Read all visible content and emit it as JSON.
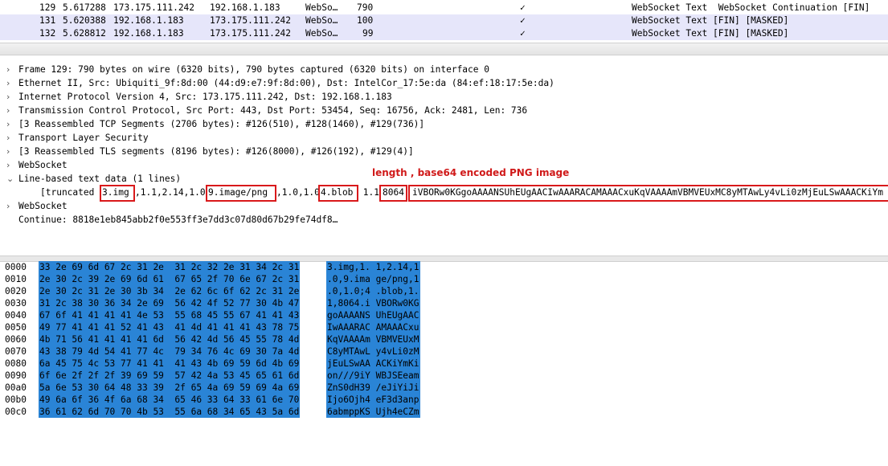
{
  "packets": [
    {
      "no": "129",
      "time": "5.617288",
      "src": "173.175.111.242",
      "dst": "192.168.1.183",
      "proto": "WebSo…",
      "len": "790",
      "check": "✓",
      "info": "WebSocket Text  WebSocket Continuation [FIN]"
    },
    {
      "no": "131",
      "time": "5.620388",
      "src": "192.168.1.183",
      "dst": "173.175.111.242",
      "proto": "WebSo…",
      "len": "100",
      "check": "✓",
      "info": "WebSocket Text [FIN] [MASKED]"
    },
    {
      "no": "132",
      "time": "5.628812",
      "src": "192.168.1.183",
      "dst": "173.175.111.242",
      "proto": "WebSo…",
      "len": "99",
      "check": "✓",
      "info": "WebSocket Text [FIN] [MASKED]"
    }
  ],
  "tree": [
    {
      "arrow": "›",
      "text": "Frame 129: 790 bytes on wire (6320 bits), 790 bytes captured (6320 bits) on interface 0"
    },
    {
      "arrow": "›",
      "text": "Ethernet II, Src: Ubiquiti_9f:8d:00 (44:d9:e7:9f:8d:00), Dst: IntelCor_17:5e:da (84:ef:18:17:5e:da)"
    },
    {
      "arrow": "›",
      "text": "Internet Protocol Version 4, Src: 173.175.111.242, Dst: 192.168.1.183"
    },
    {
      "arrow": "›",
      "text": "Transmission Control Protocol, Src Port: 443, Dst Port: 53454, Seq: 16756, Ack: 2481, Len: 736"
    },
    {
      "arrow": "›",
      "text": "[3 Reassembled TCP Segments (2706 bytes): #126(510), #128(1460), #129(736)]"
    },
    {
      "arrow": "›",
      "text": "Transport Layer Security"
    },
    {
      "arrow": "›",
      "text": "[3 Reassembled TLS segments (8196 bytes): #126(8000), #126(192), #129(4)]"
    },
    {
      "arrow": "›",
      "text": "WebSocket"
    },
    {
      "arrow": "⌄",
      "text": "Line-based text data (1 lines)"
    },
    {
      "arrow": "›",
      "text": "WebSocket"
    },
    {
      "arrow": "",
      "text": "Continue: 8818e1eb845abb2f0e553ff3e7dd3c07d80d67b29fe74df8…"
    }
  ],
  "data_line": {
    "prefix": "[truncated ",
    "seg1": "3.img",
    "sep1": ",1.1,2.14,1.0 ",
    "seg2": "9.image/png",
    "sep2": ",1.0,1.0 ",
    "seg3": "4.blob",
    "sep3": " 1.1 ",
    "seg4": "8064",
    "seg5": "iVBORw0KGgoAAAANSUhEUgAACIwAAARACAMAAACxuKqVAAAAmVBMVEUxMC8yMTAwLy4vLi0zMjEuLSwAAACKiYm"
  },
  "annotation": "length , base64 encoded PNG image",
  "hex": [
    {
      "off": "0000",
      "bytes": "33 2e 69 6d 67 2c 31 2e  31 2c 32 2e 31 34 2c 31",
      "ascii": "3.img,1. 1,2.14,1"
    },
    {
      "off": "0010",
      "bytes": "2e 30 2c 39 2e 69 6d 61  67 65 2f 70 6e 67 2c 31",
      "ascii": ".0,9.ima ge/png,1"
    },
    {
      "off": "0020",
      "bytes": "2e 30 2c 31 2e 30 3b 34  2e 62 6c 6f 62 2c 31 2e",
      "ascii": ".0,1.0;4 .blob,1."
    },
    {
      "off": "0030",
      "bytes": "31 2c 38 30 36 34 2e 69  56 42 4f 52 77 30 4b 47",
      "ascii": "1,8064.i VBORw0KG"
    },
    {
      "off": "0040",
      "bytes": "67 6f 41 41 41 41 4e 53  55 68 45 55 67 41 41 43",
      "ascii": "goAAAANS UhEUgAAC"
    },
    {
      "off": "0050",
      "bytes": "49 77 41 41 41 52 41 43  41 4d 41 41 41 43 78 75",
      "ascii": "IwAAARAC AMAAACxu"
    },
    {
      "off": "0060",
      "bytes": "4b 71 56 41 41 41 41 6d  56 42 4d 56 45 55 78 4d",
      "ascii": "KqVAAAAm VBMVEUxM"
    },
    {
      "off": "0070",
      "bytes": "43 38 79 4d 54 41 77 4c  79 34 76 4c 69 30 7a 4d",
      "ascii": "C8yMTAwL y4vLi0zM"
    },
    {
      "off": "0080",
      "bytes": "6a 45 75 4c 53 77 41 41  41 43 4b 69 59 6d 4b 69",
      "ascii": "jEuLSwAA ACKiYmKi"
    },
    {
      "off": "0090",
      "bytes": "6f 6e 2f 2f 2f 39 69 59  57 42 4a 53 45 65 61 6d",
      "ascii": "on///9iY WBJSEeam"
    },
    {
      "off": "00a0",
      "bytes": "5a 6e 53 30 64 48 33 39  2f 65 4a 69 59 69 4a 69",
      "ascii": "ZnS0dH39 /eJiYiJi"
    },
    {
      "off": "00b0",
      "bytes": "49 6a 6f 36 4f 6a 68 34  65 46 33 64 33 61 6e 70",
      "ascii": "Ijo6Ojh4 eF3d3anp"
    },
    {
      "off": "00c0",
      "bytes": "36 61 62 6d 70 70 4b 53  55 6a 68 34 65 43 5a 6d",
      "ascii": "6abmppKS Ujh4eCZm"
    }
  ]
}
